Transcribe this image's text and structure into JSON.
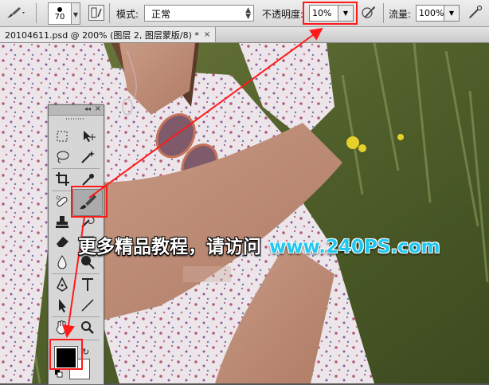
{
  "options_bar": {
    "brush_size": "70",
    "mode_label": "模式:",
    "mode_value": "正常",
    "opacity_label": "不透明度:",
    "opacity_value": "10%",
    "flow_label": "流量:",
    "flow_value": "100%",
    "icons": [
      "brush-tool-icon",
      "brush-preset-picker",
      "brush-panel-icon",
      "pressure-opacity-icon",
      "airbrush-icon"
    ]
  },
  "document_tab": {
    "title": "20104611.psd @ 200% (图层 2, 图层蒙版/8) *",
    "close_glyph": "×"
  },
  "tools_panel": {
    "tools": [
      "rectangular-marquee",
      "move",
      "lasso",
      "magic-wand",
      "crop",
      "eyedropper",
      "spot-healing-brush",
      "brush",
      "clone-stamp",
      "history-brush",
      "eraser",
      "gradient",
      "blur",
      "dodge",
      "pen",
      "type",
      "path-selection",
      "line",
      "hand",
      "zoom"
    ],
    "active_tool": "brush",
    "foreground_color": "#000000",
    "background_color": "#ffffff"
  },
  "annotation": {
    "watermark_text": "更多精品教程，请访问",
    "watermark_url": "www.240PS.com",
    "highlight_color": "#ff1a1a"
  }
}
